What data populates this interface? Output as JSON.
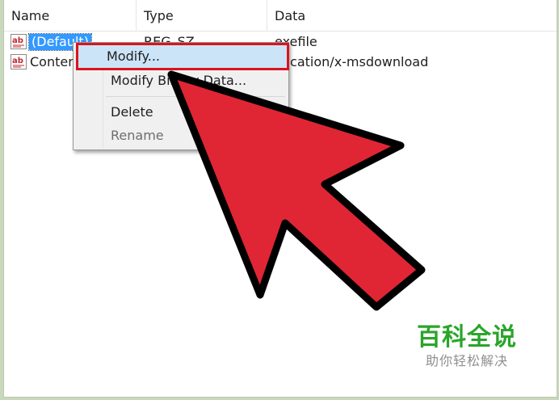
{
  "columns": {
    "name": "Name",
    "type": "Type",
    "data": "Data"
  },
  "rows": [
    {
      "name": "(Default)",
      "type": "REG_SZ",
      "data": "exefile",
      "icon": "reg-string-icon",
      "selected": true
    },
    {
      "name": "Conten",
      "type": "REG_SZ",
      "data": "plication/x-msdownload",
      "icon": "reg-string-icon",
      "selected": false
    }
  ],
  "context_menu": {
    "items": [
      {
        "label": "Modify...",
        "highlighted": true
      },
      {
        "label": "Modify Binary Data..."
      },
      {
        "label": "Delete"
      },
      {
        "label": "Rename",
        "disabled": true
      }
    ]
  },
  "annotation": {
    "highlight_color": "#d9141d",
    "arrow_color": "#e02634"
  },
  "watermark": {
    "title": "百科全说",
    "subtitle": "助你轻松解决"
  }
}
